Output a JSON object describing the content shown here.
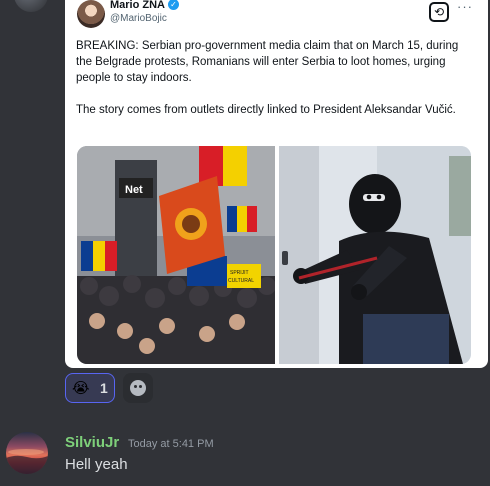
{
  "embed": {
    "author_name": "Mario ZNA",
    "author_handle": "@MarioBojic",
    "paragraph1": "BREAKING: Serbian pro-government media claim that on March 15, during the Belgrade protests, Romanians will enter Serbia to loot homes, urging people to stay indoors.",
    "paragraph2": "The story comes from outlets directly linked to President Aleksandar Vučić.",
    "media_sign_left": "Net",
    "media_sign_right": "SPRIJIT\nCULTURAL"
  },
  "reactions": [
    {
      "emoji": "😭",
      "count": "1",
      "active": true
    }
  ],
  "message": {
    "username": "SilviuJr",
    "username_color": "#7ed07a",
    "timestamp": "Today at 5:41 PM",
    "text": "Hell yeah"
  },
  "icons": {
    "add_reaction": "add-reaction-icon",
    "verified": "verified-badge-icon",
    "more": "more-options-icon"
  }
}
